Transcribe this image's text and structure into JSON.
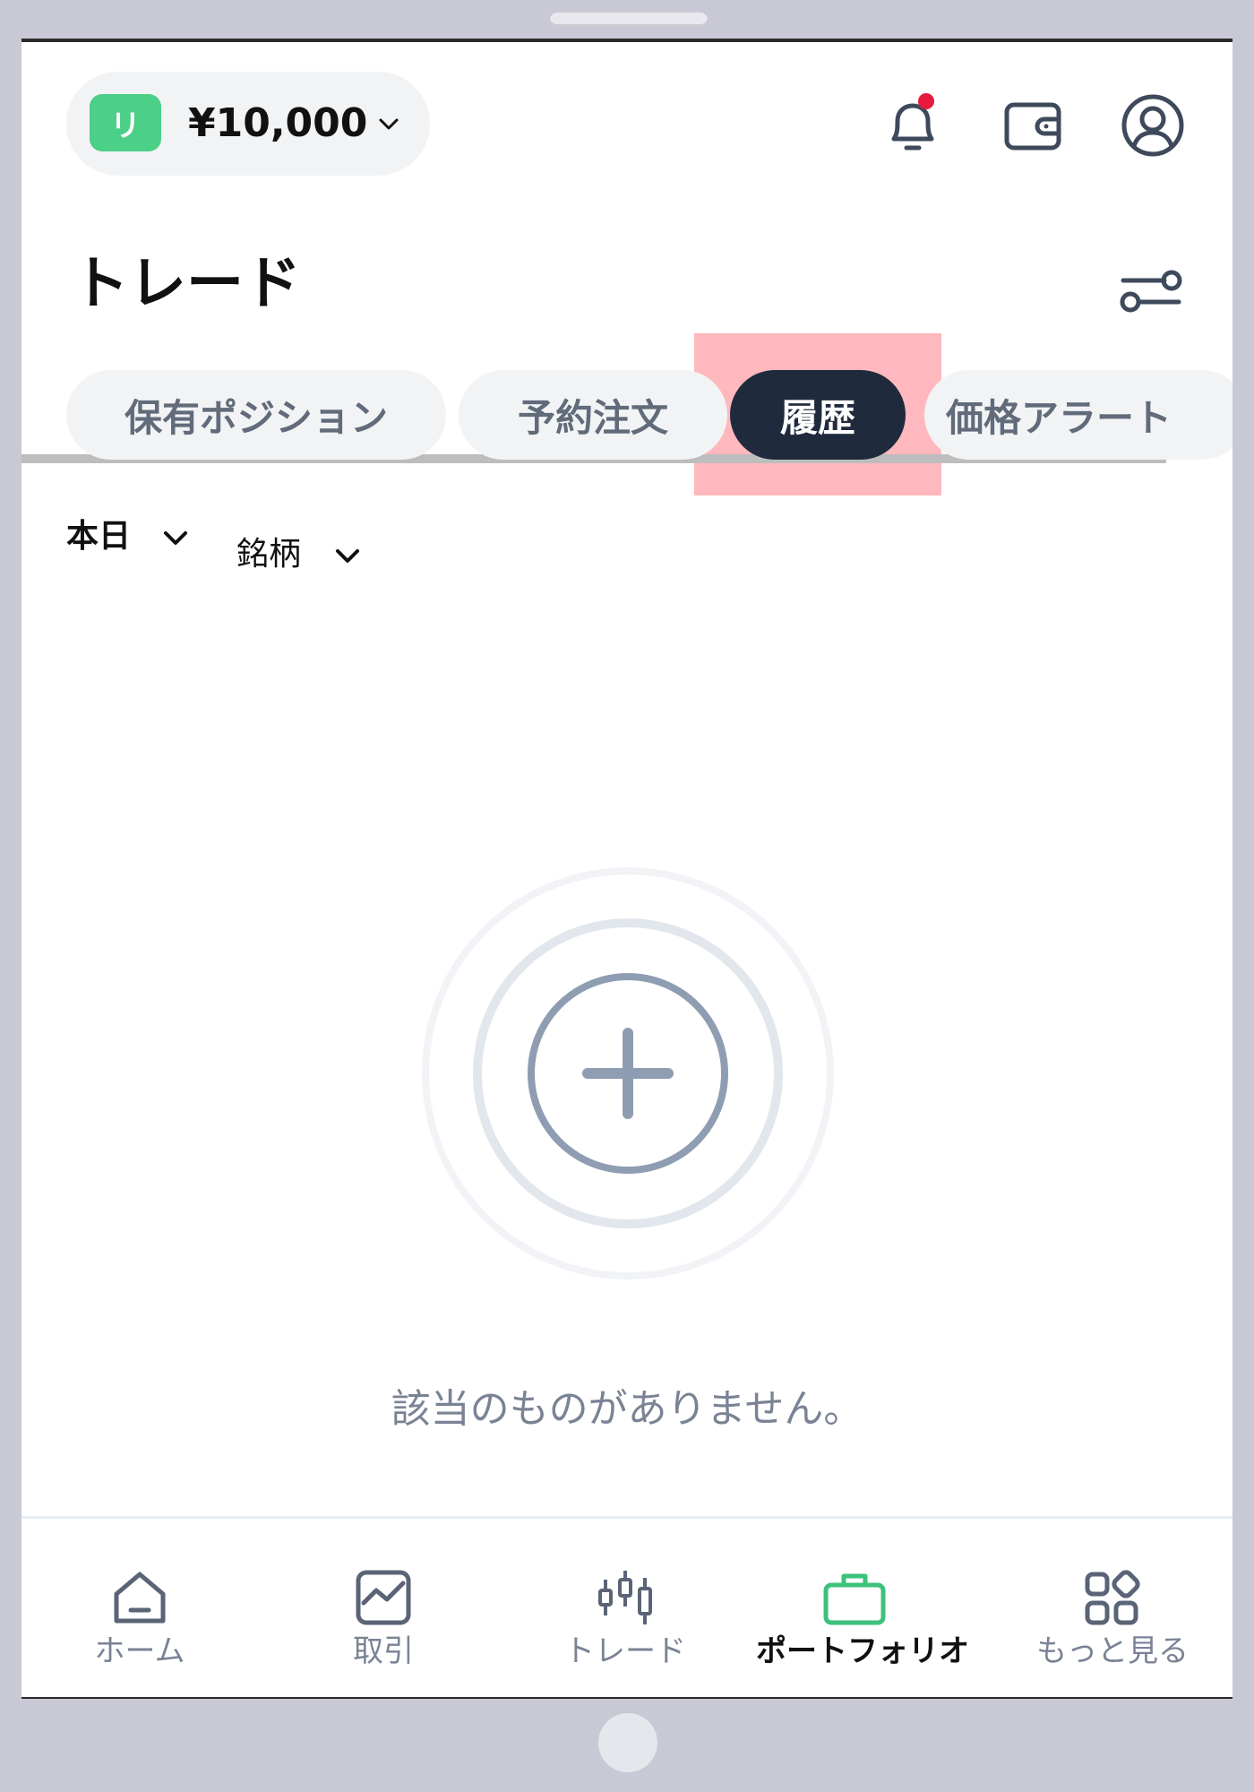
{
  "account": {
    "badge": "リ",
    "balance": "¥10,000"
  },
  "header": {
    "icons": [
      "bell-icon",
      "wallet-icon",
      "profile-icon"
    ],
    "notification_dot_color": "#e8193c"
  },
  "page": {
    "title": "トレード"
  },
  "tabs": [
    {
      "label": "保有ポジション",
      "active": false
    },
    {
      "label": "予約注文",
      "active": false
    },
    {
      "label": "履歴",
      "active": true
    },
    {
      "label": "価格アラート",
      "active": false
    }
  ],
  "filters": {
    "period": "本日",
    "symbol": "銘柄"
  },
  "empty": {
    "message": "該当のものがありません。",
    "icon": "plus-circle-icon"
  },
  "nav": [
    {
      "label": "ホーム",
      "icon": "home-icon",
      "active": false
    },
    {
      "label": "取引",
      "icon": "chart-icon",
      "active": false
    },
    {
      "label": "トレード",
      "icon": "candlestick-icon",
      "active": false
    },
    {
      "label": "ポートフォリオ",
      "icon": "briefcase-icon",
      "active": true
    },
    {
      "label": "もっと見る",
      "icon": "grid-icon",
      "active": false
    }
  ],
  "colors": {
    "accent": "#4ccf86",
    "active_tab": "#1f2a3d",
    "highlight": "#ffb8bd"
  }
}
